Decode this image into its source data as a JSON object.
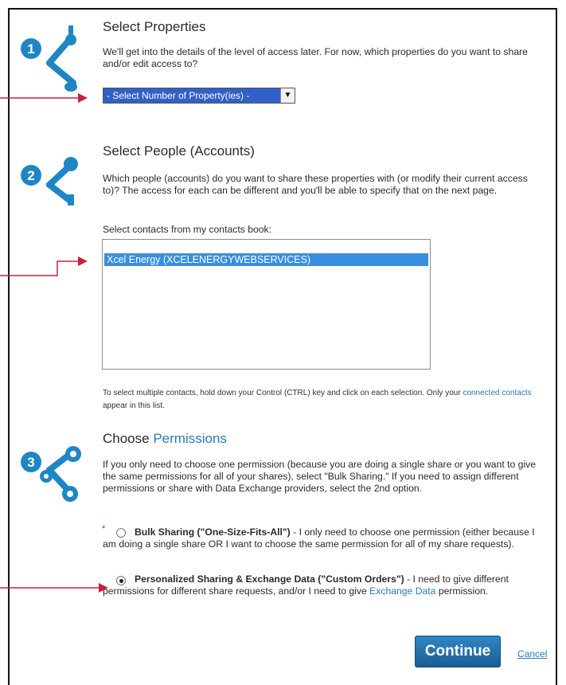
{
  "section1": {
    "number": "1",
    "title": "Select Properties",
    "description": "We'll get into the details of the level of access later. For now, which properties do you want to share and/or edit access to?",
    "select_value": "- Select Number of Property(ies) -"
  },
  "section2": {
    "number": "2",
    "title": "Select People (Accounts)",
    "description": "Which people (accounts) do you want to share these properties with (or modify their current access to)? The access for each can be different and you'll be able to specify that on the next page.",
    "contacts_label": "Select contacts from my contacts book:",
    "contacts": [
      "Xcel Energy (XCELENERGYWEBSERVICES)"
    ],
    "help_text_before": "To select multiple contacts, hold down your Control (CTRL) key and click on each selection. Only your",
    "help_link": "connected contacts",
    "help_text_after": "appear in this list."
  },
  "section3": {
    "number": "3",
    "title_prefix": "Choose",
    "title_link": "Permissions",
    "description": "If you only need to choose one permission (because you are doing a single share or you want to give the same permissions for all of your shares), select \"Bulk Sharing.\" If you need to assign different permissions or share with Data Exchange providers, select the 2nd option.",
    "required_marker": "*",
    "option1_label": "Bulk Sharing (\"One-Size-Fits-All\")",
    "option1_desc": "- I only need to choose one permission (either because I am doing a single share OR I want to choose the same permission for all of my share requests).",
    "option2_label": "Personalized Sharing & Exchange Data (\"Custom Orders\")",
    "option2_desc_before": "- I need to give different permissions for different share requests, and/or I need to give",
    "option2_link": "Exchange Data",
    "option2_desc_after": "permission."
  },
  "actions": {
    "continue_label": "Continue",
    "cancel_label": "Cancel"
  },
  "colors": {
    "accent": "#2a7ab8",
    "icon_blue": "#1f86c6",
    "annotation_arrow": "#c8203a"
  }
}
